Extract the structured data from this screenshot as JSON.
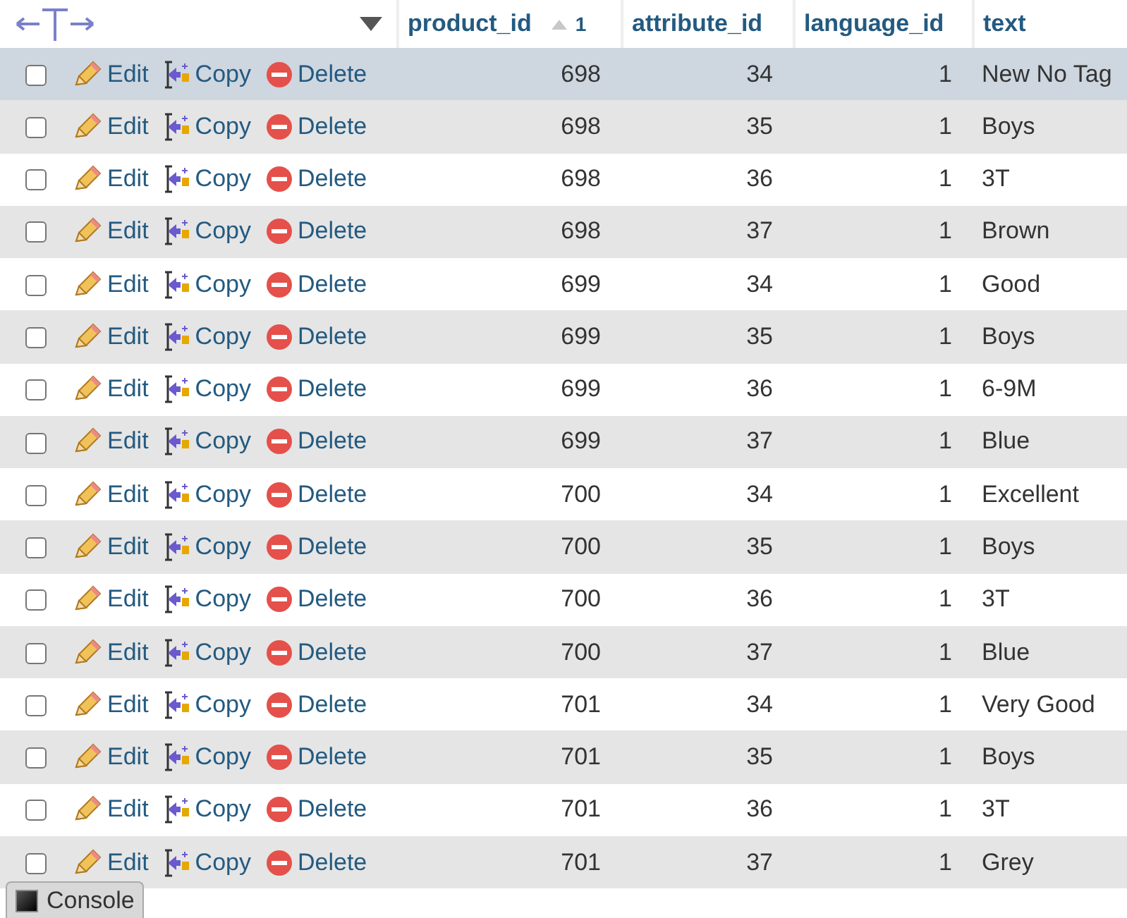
{
  "columns": [
    {
      "label": "product_id",
      "sort_order": "1"
    },
    {
      "label": "attribute_id"
    },
    {
      "label": "language_id"
    },
    {
      "label": "text"
    }
  ],
  "rows": [
    {
      "checked": false,
      "highlighted": true,
      "actions": [
        "Edit",
        "Copy",
        "Delete"
      ],
      "cells": [
        "698",
        "34",
        "1",
        "New No Tag"
      ]
    },
    {
      "checked": false,
      "highlighted": false,
      "actions": [
        "Edit",
        "Copy",
        "Delete"
      ],
      "cells": [
        "698",
        "35",
        "1",
        "Boys"
      ]
    },
    {
      "checked": false,
      "highlighted": false,
      "actions": [
        "Edit",
        "Copy",
        "Delete"
      ],
      "cells": [
        "698",
        "36",
        "1",
        "3T"
      ]
    },
    {
      "checked": false,
      "highlighted": false,
      "actions": [
        "Edit",
        "Copy",
        "Delete"
      ],
      "cells": [
        "698",
        "37",
        "1",
        "Brown"
      ]
    },
    {
      "checked": false,
      "highlighted": false,
      "actions": [
        "Edit",
        "Copy",
        "Delete"
      ],
      "cells": [
        "699",
        "34",
        "1",
        "Good"
      ]
    },
    {
      "checked": false,
      "highlighted": false,
      "actions": [
        "Edit",
        "Copy",
        "Delete"
      ],
      "cells": [
        "699",
        "35",
        "1",
        "Boys"
      ]
    },
    {
      "checked": false,
      "highlighted": false,
      "actions": [
        "Edit",
        "Copy",
        "Delete"
      ],
      "cells": [
        "699",
        "36",
        "1",
        "6-9M"
      ]
    },
    {
      "checked": false,
      "highlighted": false,
      "actions": [
        "Edit",
        "Copy",
        "Delete"
      ],
      "cells": [
        "699",
        "37",
        "1",
        "Blue"
      ]
    },
    {
      "checked": false,
      "highlighted": false,
      "actions": [
        "Edit",
        "Copy",
        "Delete"
      ],
      "cells": [
        "700",
        "34",
        "1",
        "Excellent"
      ]
    },
    {
      "checked": false,
      "highlighted": false,
      "actions": [
        "Edit",
        "Copy",
        "Delete"
      ],
      "cells": [
        "700",
        "35",
        "1",
        "Boys"
      ]
    },
    {
      "checked": false,
      "highlighted": false,
      "actions": [
        "Edit",
        "Copy",
        "Delete"
      ],
      "cells": [
        "700",
        "36",
        "1",
        "3T"
      ]
    },
    {
      "checked": false,
      "highlighted": false,
      "actions": [
        "Edit",
        "Copy",
        "Delete"
      ],
      "cells": [
        "700",
        "37",
        "1",
        "Blue"
      ]
    },
    {
      "checked": false,
      "highlighted": false,
      "actions": [
        "Edit",
        "Copy",
        "Delete"
      ],
      "cells": [
        "701",
        "34",
        "1",
        "Very Good"
      ]
    },
    {
      "checked": false,
      "highlighted": false,
      "actions": [
        "Edit",
        "Copy",
        "Delete"
      ],
      "cells": [
        "701",
        "35",
        "1",
        "Boys"
      ]
    },
    {
      "checked": false,
      "highlighted": false,
      "actions": [
        "Edit",
        "Copy",
        "Delete"
      ],
      "cells": [
        "701",
        "36",
        "1",
        "3T"
      ]
    },
    {
      "checked": false,
      "highlighted": false,
      "actions": [
        "Edit",
        "Copy",
        "Delete"
      ],
      "cells": [
        "701",
        "37",
        "1",
        "Grey"
      ]
    }
  ],
  "console": {
    "label": "Console"
  }
}
